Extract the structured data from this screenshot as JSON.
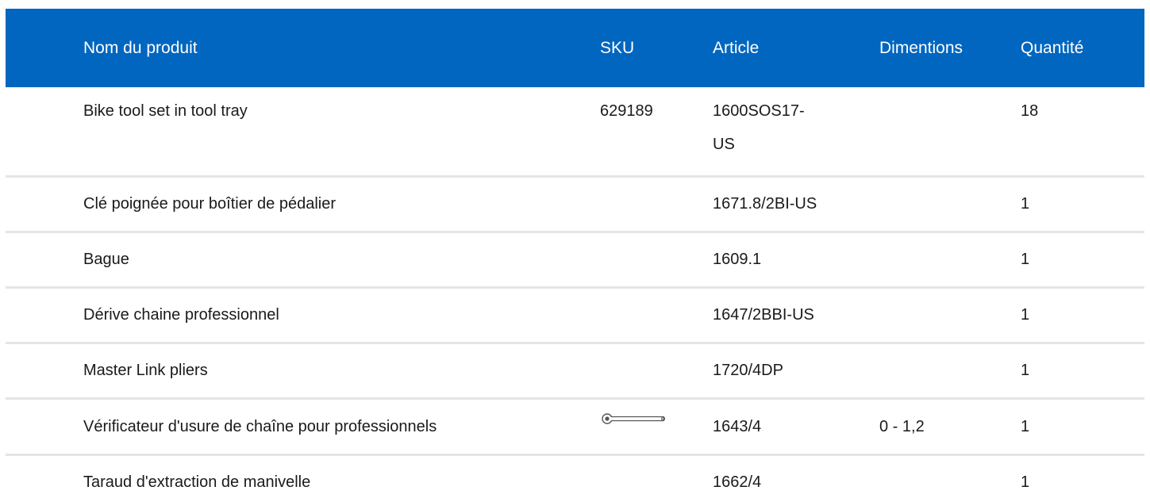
{
  "table": {
    "headers": {
      "name": "Nom du produit",
      "sku": "SKU",
      "article": "Article",
      "dimensions": "Dimentions",
      "quantity": "Quantité"
    },
    "rows": [
      {
        "name": "Bike tool set in tool tray",
        "sku": "629189",
        "article_line1": "1600SOS17-",
        "article_line2": "US",
        "dimensions": "",
        "quantity": "18"
      },
      {
        "name": "Clé poignée pour boîtier de pédalier",
        "sku": "",
        "article": "1671.8/2BI-US",
        "dimensions": "",
        "quantity": "1"
      },
      {
        "name": "Bague",
        "sku": "",
        "article": "1609.1",
        "dimensions": "",
        "quantity": "1"
      },
      {
        "name": "Dérive chaine professionnel",
        "sku": "",
        "article": "1647/2BBI-US",
        "dimensions": "",
        "quantity": "1"
      },
      {
        "name": "Master Link pliers",
        "sku": "",
        "article": "1720/4DP",
        "dimensions": "",
        "quantity": "1"
      },
      {
        "name": "Vérificateur d'usure de chaîne pour professionnels",
        "sku_icon": "chain-wear-checker-tool-icon",
        "article": "1643/4",
        "dimensions": "0 - 1,2",
        "quantity": "1"
      },
      {
        "name": "Taraud d'extraction de manivelle",
        "sku": "",
        "article": "1662/4",
        "dimensions": "",
        "quantity": "1"
      }
    ]
  },
  "colors": {
    "header_bg": "#0066bf",
    "header_text": "#ffffff",
    "row_divider": "#e5e5e5"
  }
}
